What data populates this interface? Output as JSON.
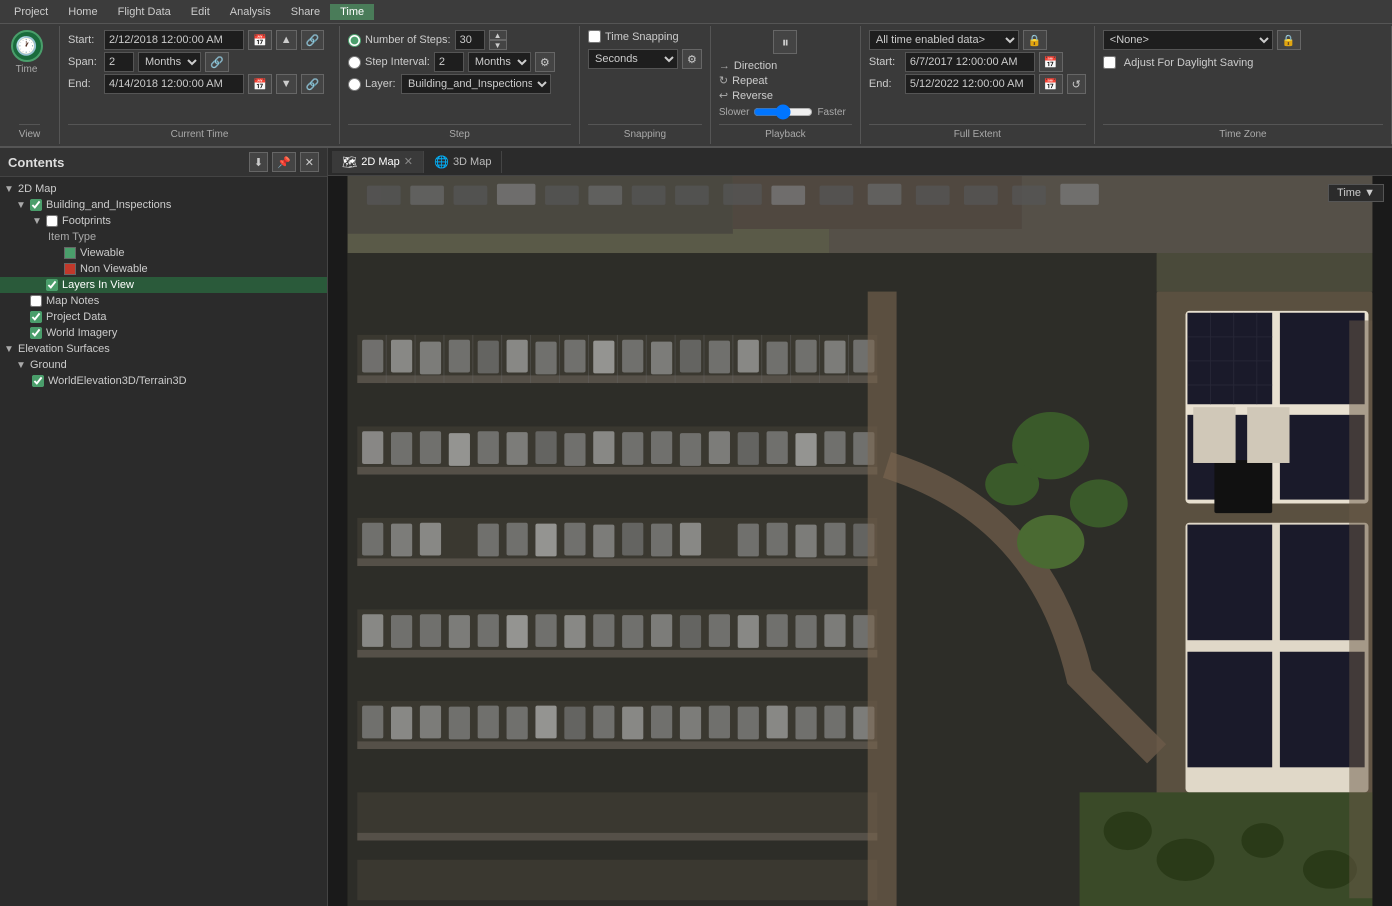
{
  "menu": {
    "items": [
      "Project",
      "Home",
      "Flight Data",
      "Edit",
      "Analysis",
      "Share",
      "Time"
    ],
    "active": "Time"
  },
  "ribbon": {
    "view_section": "View",
    "current_time_section": "Current Time",
    "step_section": "Step",
    "snapping_section": "Snapping",
    "playback_section": "Playback",
    "full_extent_section": "Full Extent",
    "time_zone_section": "Time Zone",
    "time_label": "Time",
    "start_label": "Start:",
    "span_label": "Span:",
    "end_label": "End:",
    "start_value": "2/12/2018 12:00:00 AM",
    "span_value": "2",
    "end_value": "4/14/2018 12:00:00 AM",
    "span_unit": "Months",
    "num_steps_label": "Number of Steps:",
    "num_steps_value": "30",
    "step_interval_label": "Step Interval:",
    "step_interval_value": "2",
    "step_interval_unit": "Months",
    "layer_label": "Layer:",
    "layer_value": "Building_and_Inspections",
    "time_snapping_label": "Time Snapping",
    "seconds_label": "Seconds",
    "slower_label": "Slower",
    "faster_label": "Faster",
    "direction_label": "Direction",
    "repeat_label": "Repeat",
    "reverse_label": "Reverse",
    "pause_symbol": "⏸",
    "full_extent_dropdown": "All time enabled data>",
    "fe_start_label": "Start:",
    "fe_start_value": "6/7/2017 12:00:00 AM",
    "fe_end_label": "End:",
    "fe_end_value": "5/12/2022 12:00:00 AM",
    "tz_none": "<None>",
    "adjust_daylight": "Adjust For Daylight Saving"
  },
  "contents": {
    "title": "Contents",
    "tree": [
      {
        "id": "2dmap",
        "label": "2D Map",
        "level": 0,
        "type": "group",
        "expanded": true,
        "checked": null
      },
      {
        "id": "building",
        "label": "Building_and_Inspections",
        "level": 1,
        "type": "layer",
        "expanded": true,
        "checked": true
      },
      {
        "id": "footprints",
        "label": "Footprints",
        "level": 2,
        "type": "layer",
        "expanded": true,
        "checked": false
      },
      {
        "id": "itemtype",
        "label": "Item Type",
        "level": 3,
        "type": "label",
        "expanded": false,
        "checked": null
      },
      {
        "id": "viewable",
        "label": "Viewable",
        "level": 4,
        "type": "symbol",
        "color": "#4a9e6b",
        "checked": null
      },
      {
        "id": "nonviewable",
        "label": "Non Viewable",
        "level": 4,
        "type": "symbol",
        "color": "#c0392b",
        "checked": null
      },
      {
        "id": "layersinview",
        "label": "Layers In View",
        "level": 2,
        "type": "layer",
        "checked": true,
        "selected": true
      },
      {
        "id": "mapnotes",
        "label": "Map Notes",
        "level": 1,
        "type": "layer",
        "checked": false
      },
      {
        "id": "projectdata",
        "label": "Project Data",
        "level": 1,
        "type": "layer",
        "checked": true
      },
      {
        "id": "worldimagery",
        "label": "World Imagery",
        "level": 1,
        "type": "layer",
        "checked": true
      },
      {
        "id": "elevsurfaces",
        "label": "Elevation Surfaces",
        "level": 0,
        "type": "group",
        "expanded": true
      },
      {
        "id": "ground",
        "label": "Ground",
        "level": 1,
        "type": "group",
        "expanded": true
      },
      {
        "id": "worldelev",
        "label": "WorldElevation3D/Terrain3D",
        "level": 2,
        "type": "layer",
        "checked": true
      }
    ]
  },
  "tabs": [
    {
      "label": "2D Map",
      "active": true,
      "icon": "🗺"
    },
    {
      "label": "3D Map",
      "active": false,
      "icon": "🌐"
    }
  ],
  "map": {
    "time_btn": "Time ▼"
  }
}
